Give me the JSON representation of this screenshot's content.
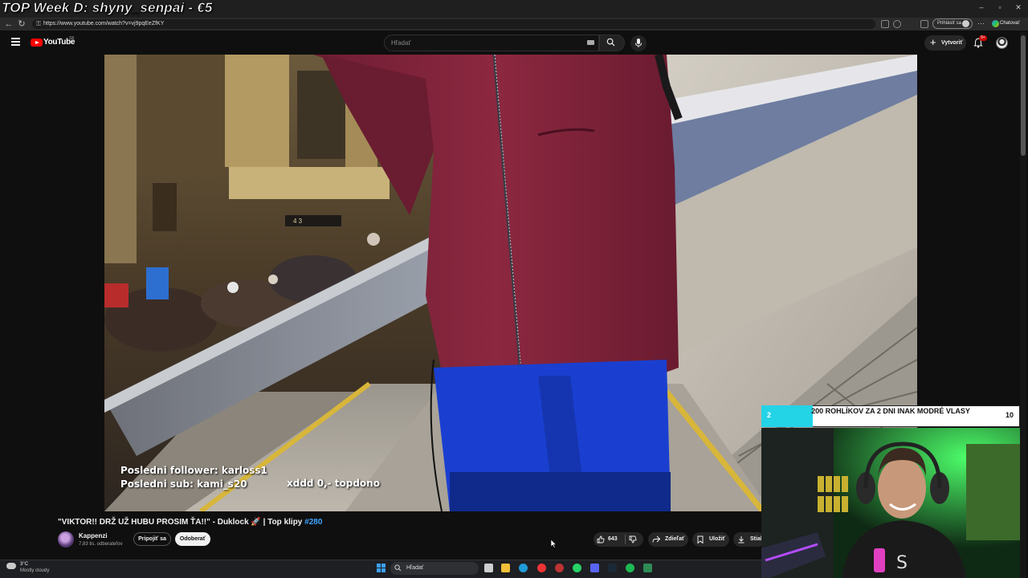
{
  "stream": {
    "overlay_title": "TOP Week D: shyny_senpai - €5",
    "last_follower": "Posledni follower: karloss1",
    "last_sub": "Posledni sub: kami_s20",
    "donation_note": "xddd 0,- topdono",
    "goal_text": "200 ROHLÍKOV ZA 2 DNI INAK MODRÉ VLASY",
    "goal_current": "2",
    "goal_target": "10",
    "goal_progress": 0.2
  },
  "browser": {
    "url": "https://www.youtube.com/watch?v=vj9pqEeZfKY",
    "signin_label": "Prihlásiť sa",
    "chat_label": "Chatovať",
    "minimize": "–",
    "maximize": "▫",
    "close": "✕"
  },
  "youtube": {
    "logo_text": "YouTube",
    "region": "SK",
    "search_placeholder": "Hľadať",
    "create_label": "Vytvoriť",
    "notification_badge": "9+"
  },
  "video": {
    "title": "\"VIKTOR!! DRŽ UŽ HUBU PROSIM ŤA!!\" - Duklock 🚀 | Top klipy ",
    "title_tag": "#280",
    "channel": "Kappenzi",
    "subscribers": "7,83 tis. odberateľov",
    "join_label": "Pripojiť sa",
    "subscribe_label": "Odoberať",
    "likes": "643",
    "share_label": "Zdieľať",
    "save_label": "Uložiť",
    "download_label": "Stiahnuť"
  },
  "taskbar": {
    "temperature": "3°C",
    "weather": "Mostly cloudy",
    "search_placeholder": "Hľadať"
  }
}
